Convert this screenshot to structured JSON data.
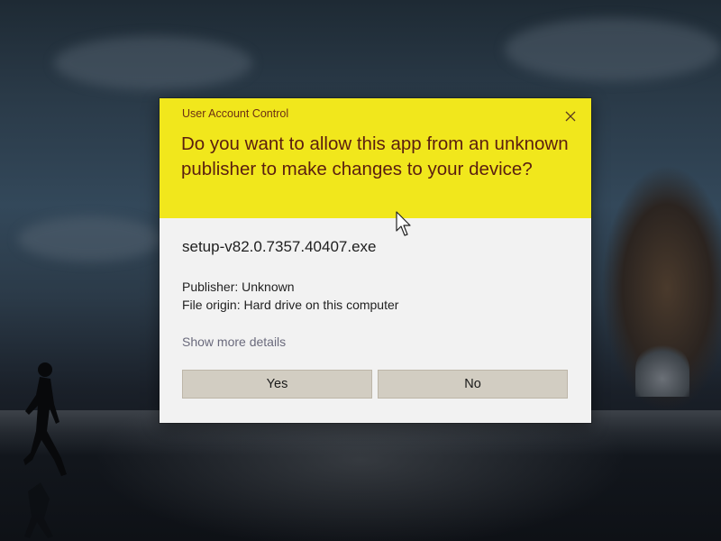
{
  "dialog": {
    "caption": "User Account Control",
    "question": "Do you want to allow this app from an unknown publisher to make changes to your device?",
    "file_name": "setup-v82.0.7357.40407.exe",
    "publisher_line": "Publisher: Unknown",
    "origin_line": "File origin: Hard drive on this computer",
    "details_link": "Show more details",
    "yes_label": "Yes",
    "no_label": "No",
    "close_icon": "close-icon"
  },
  "colors": {
    "header_background": "#f1e71c",
    "caption_text": "#6b2f14",
    "question_text": "#5a1e10",
    "body_background": "#f2f2f2",
    "button_background": "#d2cdc2",
    "link_text": "#6a6a7c"
  },
  "icons": [
    "close-icon",
    "mouse-pointer-icon"
  ]
}
